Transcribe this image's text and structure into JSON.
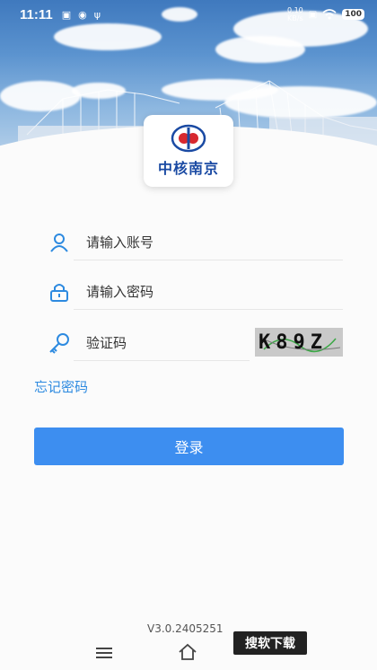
{
  "status_bar": {
    "time": "11:11",
    "net_speed_value": "0.10",
    "net_speed_unit": "KB/s",
    "battery": "100",
    "icons": [
      "notification-icon",
      "eye-icon",
      "usb-icon",
      "sim-icon",
      "wifi-icon",
      "battery-icon"
    ]
  },
  "brand": {
    "logo_text": "中核南京",
    "color": "#1a4aa3"
  },
  "form": {
    "account_placeholder": "请输入账号",
    "password_placeholder": "请输入密码",
    "captcha_placeholder": "验证码",
    "captcha_text": "K89Z",
    "forgot_password": "忘记密码",
    "login_button": "登录"
  },
  "colors": {
    "accent": "#3d8ef0",
    "link": "#2d8ae0"
  },
  "footer": {
    "version": "V3.0.2405251",
    "watermark": "搜软下载"
  }
}
